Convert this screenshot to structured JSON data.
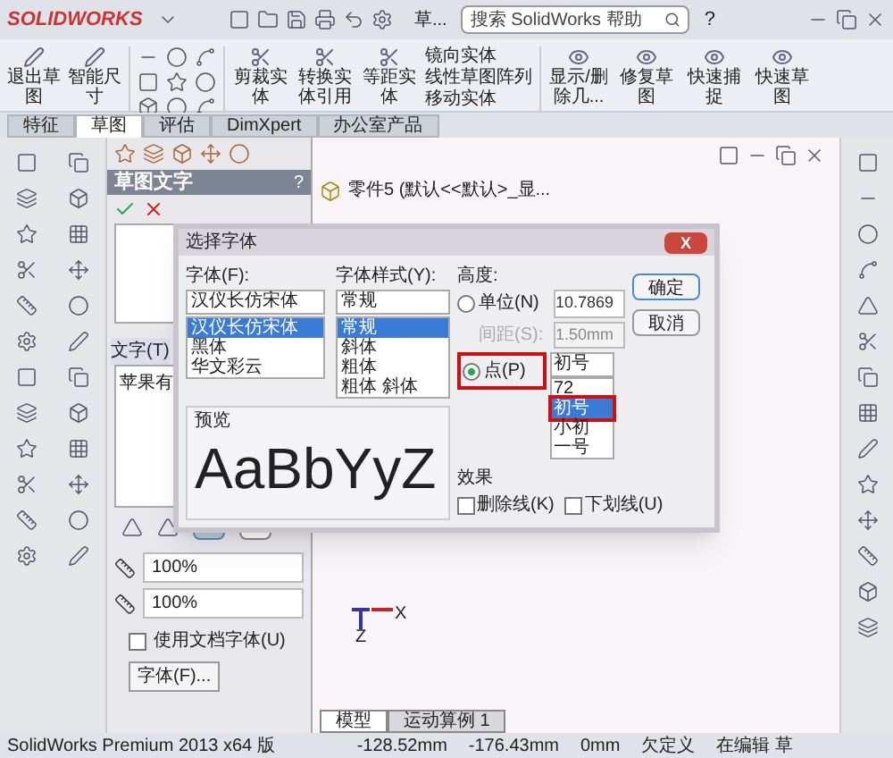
{
  "app": {
    "logo": "SOLIDWORKS",
    "doc_title": "草...",
    "search_placeholder": "搜索 SolidWorks 帮助",
    "help": "?"
  },
  "ribbon": {
    "sketch_buttons": [
      "退出草图",
      "智能尺寸"
    ],
    "edit_buttons": [
      "剪裁实体",
      "转换实体引用",
      "等距实体"
    ],
    "list_items": [
      "镜向实体",
      "线性草图阵列",
      "移动实体"
    ],
    "right_buttons": [
      "显示/删除几...",
      "修复草图",
      "快速捕捉",
      "快速草图"
    ]
  },
  "tabs": [
    {
      "label": "特征",
      "selected": false
    },
    {
      "label": "草图",
      "selected": true
    },
    {
      "label": "评估",
      "selected": false
    },
    {
      "label": "DimXpert",
      "selected": false
    },
    {
      "label": "办公室产品",
      "selected": false
    }
  ],
  "property_panel": {
    "title": "草图文字",
    "help": "?",
    "text_label": "文字(T)",
    "text_value": "苹果有",
    "width_value": "100%",
    "spacing_value": "100%",
    "use_doc_font": {
      "label": "使用文档字体(U)",
      "checked": false
    },
    "font_button": "字体(F)..."
  },
  "tree": {
    "item": "零件5  (默认<<默认>_显..."
  },
  "triad": {
    "x_label": "X",
    "z_label": "Z"
  },
  "dialog": {
    "title": "选择字体",
    "close": "X",
    "font": {
      "label": "字体(F):",
      "value": "汉仪长仿宋体",
      "options": [
        {
          "label": "汉仪长仿宋体",
          "selected": true
        },
        {
          "label": "黑体",
          "selected": false
        },
        {
          "label": "华文彩云",
          "selected": false
        }
      ]
    },
    "style": {
      "label": "字体样式(Y):",
      "value": "常规",
      "options": [
        {
          "label": "常规",
          "selected": true
        },
        {
          "label": "斜体",
          "selected": false
        },
        {
          "label": "粗体",
          "selected": false
        },
        {
          "label": "粗体 斜体",
          "selected": false
        }
      ]
    },
    "height": {
      "label": "高度:",
      "units": {
        "label": "单位(N)",
        "value": "10.7869",
        "selected": false
      },
      "spacing": {
        "label": "间距(S):",
        "value": "1.50mm",
        "disabled": true
      },
      "points": {
        "label": "点(P)",
        "value": "初号",
        "selected": true
      },
      "sizes": [
        {
          "label": "72",
          "selected": false
        },
        {
          "label": "初号",
          "selected": true
        },
        {
          "label": "小初",
          "selected": false
        },
        {
          "label": "一号",
          "selected": false
        }
      ]
    },
    "effects": {
      "label": "效果",
      "options": [
        {
          "label": "删除线(K)",
          "checked": false
        },
        {
          "label": "下划线(U)",
          "checked": false
        }
      ]
    },
    "preview": {
      "label": "预览",
      "sample": "AaBbYyZ"
    },
    "buttons": [
      "确定",
      "取消"
    ]
  },
  "bottom_tabs": [
    {
      "label": "模型",
      "selected": true
    },
    {
      "label": "运动算例 1",
      "selected": false
    }
  ],
  "status_bar": [
    "SolidWorks Premium 2013 x64 版",
    "-128.52mm",
    "-176.43mm",
    "0mm",
    "欠定义",
    "在编辑 草"
  ]
}
